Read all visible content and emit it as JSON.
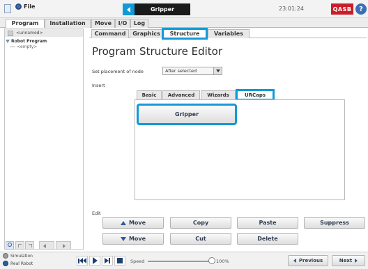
{
  "topbar": {
    "file_label": "File",
    "gripper_title": "Gripper",
    "clock": "23:01:24",
    "logo": "QASB",
    "help_symbol": "?"
  },
  "main_tabs": [
    "Program",
    "Installation",
    "Move",
    "I/O",
    "Log"
  ],
  "sub_tabs": [
    "Command",
    "Graphics",
    "Structure",
    "Variables"
  ],
  "tree": {
    "header": "<unnamed>",
    "root": "Robot Program",
    "child": "<empty>"
  },
  "editor": {
    "title": "Program Structure Editor",
    "placement_label": "Set placement of node",
    "placement_value": "After selected",
    "insert_label": "Insert",
    "insert_tabs": [
      "Basic",
      "Advanced",
      "Wizards",
      "URCaps"
    ],
    "gripper_button": "Gripper",
    "edit_label": "Edit",
    "edit_buttons": {
      "move_up": "Move",
      "copy": "Copy",
      "paste": "Paste",
      "suppress": "Suppress",
      "move_down": "Move",
      "cut": "Cut",
      "delete": "Delete"
    }
  },
  "bottombar": {
    "simulation": "Simulation",
    "real_robot": "Real Robot",
    "speed_label": "Speed",
    "speed_value": "100%",
    "speed_fraction": 1.0,
    "previous": "Previous",
    "next": "Next"
  },
  "colors": {
    "highlight": "#139ad6",
    "dark_tab": "#1a1a1a",
    "logo_red": "#c81e2a",
    "help_blue": "#3b6fb6"
  }
}
